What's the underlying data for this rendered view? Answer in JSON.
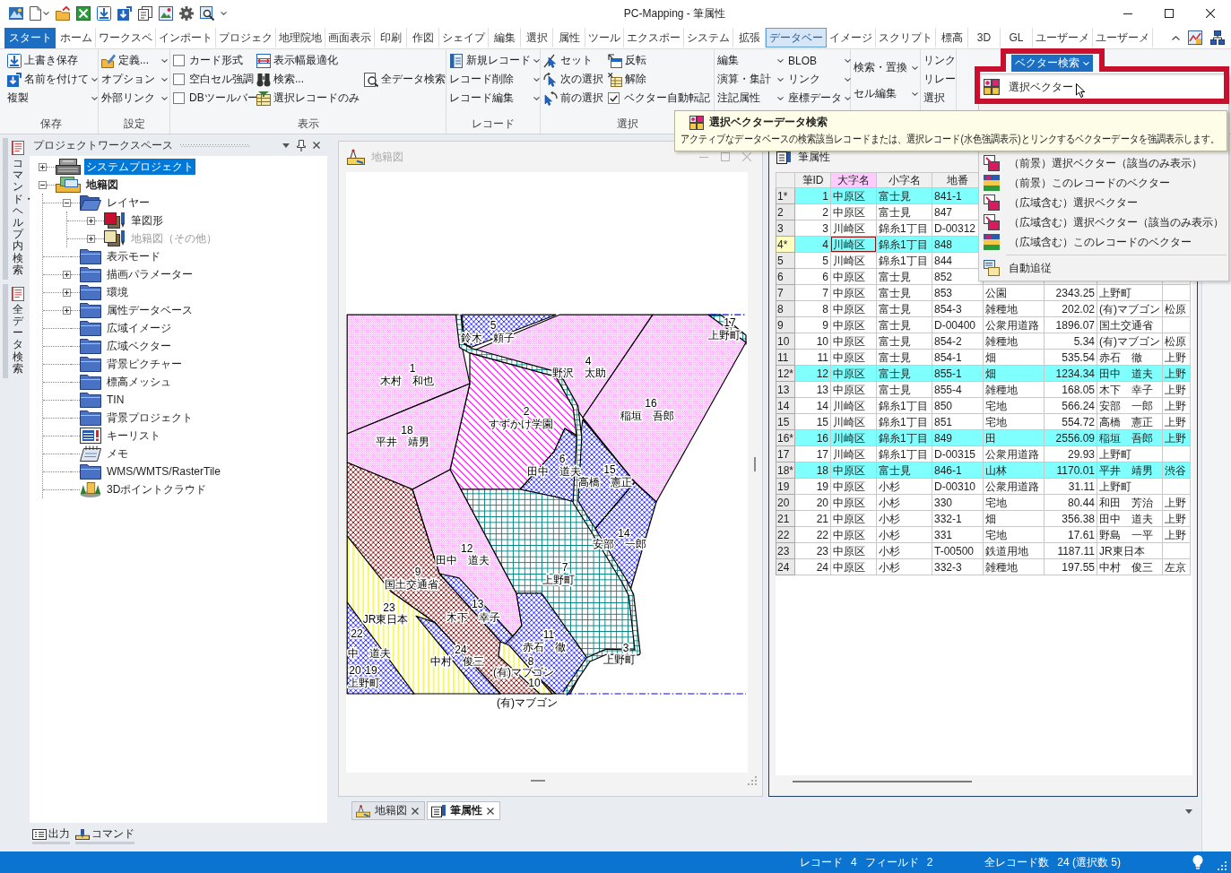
{
  "window": {
    "title": "PC-Mapping - 筆属性"
  },
  "ribbon": {
    "app_button": "スタート",
    "tabs": [
      {
        "label": "ホーム",
        "selected": false
      },
      {
        "label": "ワークスペ",
        "selected": false
      },
      {
        "label": "インポート",
        "selected": false
      },
      {
        "label": "プロジェク",
        "selected": false
      },
      {
        "label": "地理院地",
        "selected": false
      },
      {
        "label": "画面表示",
        "selected": false
      },
      {
        "label": "印刷",
        "selected": false
      },
      {
        "label": "作図",
        "selected": false
      },
      {
        "label": "シェイプ",
        "selected": false
      },
      {
        "label": "編集",
        "selected": false
      },
      {
        "label": "選択",
        "selected": false
      },
      {
        "label": "属性",
        "selected": false
      },
      {
        "label": "ツール",
        "selected": false
      },
      {
        "label": "エクスポー",
        "selected": false
      },
      {
        "label": "システム",
        "selected": false
      },
      {
        "label": "拡張",
        "selected": false
      },
      {
        "label": "データベー",
        "selected": true
      },
      {
        "label": "イメージ",
        "selected": false
      },
      {
        "label": "スクリプト",
        "selected": false
      },
      {
        "label": "標高",
        "selected": false
      },
      {
        "label": "3D",
        "selected": false
      },
      {
        "label": "GL",
        "selected": false
      },
      {
        "label": "ユーザーメ",
        "selected": false
      },
      {
        "label": "ユーザーメ",
        "selected": false
      }
    ],
    "groups": [
      {
        "label": "保存",
        "columns": [
          [
            {
              "kind": "icon",
              "label": "上書き保存"
            },
            {
              "kind": "icon_menu",
              "label": "名前を付けて"
            },
            {
              "kind": "menu",
              "label": "複製"
            }
          ]
        ]
      },
      {
        "label": "設定",
        "columns": [
          [
            {
              "kind": "icon_menu",
              "label": "定義..."
            },
            {
              "kind": "menu",
              "label": "オプション"
            },
            {
              "kind": "menu",
              "label": "外部リンク"
            }
          ]
        ]
      },
      {
        "label": "表示",
        "columns": [
          [
            {
              "kind": "check",
              "label": "カード形式",
              "checked": false
            },
            {
              "kind": "check",
              "label": "空白セル強調",
              "checked": false
            },
            {
              "kind": "check",
              "label": "DBツールバー",
              "checked": false
            }
          ],
          [
            {
              "kind": "icon",
              "label": "表示幅最適化"
            },
            {
              "kind": "icon",
              "label": "検索..."
            },
            {
              "kind": "icon",
              "label": "選択レコードのみ"
            }
          ],
          [
            {
              "kind": "icon",
              "label": "全データ検索"
            }
          ]
        ]
      },
      {
        "label": "レコード",
        "columns": [
          [
            {
              "kind": "icon_menu",
              "label": "新規レコード"
            },
            {
              "kind": "menu",
              "label": "レコード削除"
            },
            {
              "kind": "menu",
              "label": "レコード編集"
            }
          ]
        ]
      },
      {
        "label": "選択",
        "columns": [
          [
            {
              "kind": "icon",
              "label": "セット"
            },
            {
              "kind": "icon",
              "label": "次の選択"
            },
            {
              "kind": "icon",
              "label": "前の選択"
            }
          ],
          [
            {
              "kind": "icon",
              "label": "反転"
            },
            {
              "kind": "icon",
              "label": "解除"
            },
            {
              "kind": "check",
              "label": "ベクター自動転記",
              "checked": true
            }
          ]
        ]
      },
      {
        "columns": [
          [
            {
              "kind": "menu",
              "label": "編集"
            },
            {
              "kind": "menu",
              "label": "演算・集計"
            },
            {
              "kind": "menu",
              "label": "注記属性"
            }
          ],
          [
            {
              "kind": "menu",
              "label": "BLOB"
            },
            {
              "kind": "menu",
              "label": "リンク"
            },
            {
              "kind": "menu",
              "label": "座標データ"
            }
          ]
        ]
      },
      {
        "columns": [
          [
            {
              "kind": "menu",
              "label": "検索・置換"
            },
            {
              "kind": "menu",
              "label": "セル編集"
            }
          ]
        ]
      },
      {
        "columns": [
          [
            {
              "kind": "text",
              "label": "リンク"
            },
            {
              "kind": "text",
              "label": "リレー"
            },
            {
              "kind": "text",
              "label": "選択"
            }
          ]
        ]
      }
    ],
    "vector_search": {
      "label": "ベクター検索",
      "expanded": true
    }
  },
  "vector_menu": {
    "items": [
      {
        "kind": "item",
        "label": "選択ベクター",
        "selected": true
      },
      {
        "kind": "item",
        "label": "（前景）選択ベクター（該当のみ表示）",
        "selected": false
      },
      {
        "kind": "item",
        "label": "（前景）このレコードのベクター",
        "selected": false
      },
      {
        "kind": "item",
        "label": "（広域含む）選択ベクター",
        "selected": false
      },
      {
        "kind": "item",
        "label": "（広域含む）選択ベクター（該当のみ表示）",
        "selected": false
      },
      {
        "kind": "item",
        "label": "（広域含む）このレコードのベクター",
        "selected": false
      },
      {
        "kind": "separator"
      },
      {
        "kind": "item",
        "label": "自動追従",
        "selected": false
      }
    ]
  },
  "tooltip": {
    "title": "選択ベクターデータ検索",
    "text": "アクティブなデータベースの検索該当レコードまたは、選択レコード(水色強調表示)とリンクするベクターデータを強調表示します。"
  },
  "side_tabs": [
    {
      "label": "コマンド・ヘルプ内検索"
    },
    {
      "label": "全データ検索"
    }
  ],
  "workspace": {
    "title": "プロジェクトワークスペース",
    "tree": [
      {
        "kind": "system",
        "label": "システムプロジェクト",
        "expanded": false,
        "selected": true,
        "active": false
      },
      {
        "kind": "project",
        "label": "地籍図",
        "expanded": true,
        "selected": false,
        "active": true,
        "children": [
          {
            "kind": "open_folder",
            "label": "レイヤー",
            "expanded": true,
            "selected": false,
            "children": [
              {
                "kind": "layer",
                "label": "筆図形",
                "expanded": false,
                "selected": false,
                "disabled": false,
                "color": "#c8102e"
              },
              {
                "kind": "layer",
                "label": "地籍図（その他）",
                "expanded": false,
                "selected": false,
                "disabled": true,
                "color": "#efe3b4"
              }
            ]
          },
          {
            "kind": "folder",
            "label": "表示モード",
            "selected": false
          },
          {
            "kind": "folder",
            "label": "描画パラメーター",
            "expanded": false,
            "selected": false
          },
          {
            "kind": "folder",
            "label": "環境",
            "expanded": false,
            "selected": false
          },
          {
            "kind": "folder",
            "label": "属性データベース",
            "expanded": false,
            "selected": false
          },
          {
            "kind": "folder",
            "label": "広域イメージ",
            "selected": false
          },
          {
            "kind": "folder",
            "label": "広域ベクター",
            "selected": false
          },
          {
            "kind": "folder",
            "label": "背景ピクチャー",
            "selected": false
          },
          {
            "kind": "folder",
            "label": "標高メッシュ",
            "selected": false
          },
          {
            "kind": "folder",
            "label": "TIN",
            "selected": false
          },
          {
            "kind": "folder",
            "label": "背景プロジェクト",
            "selected": false
          },
          {
            "kind": "keylist",
            "label": "キーリスト",
            "selected": false
          },
          {
            "kind": "memo",
            "label": "メモ",
            "selected": false
          },
          {
            "kind": "folder",
            "label": "WMS/WMTS/RasterTile",
            "selected": false
          },
          {
            "kind": "pointcloud",
            "label": "3Dポイントクラウド",
            "selected": false
          }
        ]
      }
    ]
  },
  "panel_tabs": [
    {
      "label": "出力"
    },
    {
      "label": "コマンド"
    }
  ],
  "map_window": {
    "title": "地籍図",
    "active": false,
    "parcels": [
      {
        "number": "5",
        "name": "鈴木　頼子",
        "kind": "bluehatch"
      },
      {
        "number": "17",
        "name": "上野町",
        "kind": "grid"
      },
      {
        "number": "1",
        "name": "木村　和也",
        "kind": "dots"
      },
      {
        "number": "4",
        "name": "野沢　太助",
        "kind": "dots"
      },
      {
        "number": "16",
        "name": "稲垣　吾郎",
        "kind": "dots"
      },
      {
        "number": "2",
        "name": "すずかけ学園",
        "kind": "diagonal"
      },
      {
        "number": "18",
        "name": "平井　靖男",
        "kind": "dots"
      },
      {
        "number": "6",
        "name": "田中　道夫",
        "kind": "bluehatch"
      },
      {
        "number": "15",
        "name": "高橋　憲正",
        "kind": "bluehatch"
      },
      {
        "number": "14",
        "name": "安部　一郎",
        "kind": "bluehatch"
      },
      {
        "number": "12",
        "name": "田中　道夫",
        "kind": "dots"
      },
      {
        "number": "9",
        "name": "国土交通省",
        "kind": "brownhatch"
      },
      {
        "number": "7",
        "name": "上野町",
        "kind": "grid"
      },
      {
        "number": "23",
        "name": "JR東日本",
        "kind": "stripes"
      },
      {
        "number": "13",
        "name": "木下　幸子",
        "kind": "bluehatch"
      },
      {
        "number": "22",
        "kind": "bluehatch"
      },
      {
        "name": "中　道夫"
      },
      {
        "number": "20"
      },
      {
        "number": "19",
        "name": "上野町"
      },
      {
        "number": "24",
        "name": "中村　俊三",
        "kind": "bluehatch"
      },
      {
        "number": "11",
        "name": "赤石　徹",
        "kind": "bluehatch"
      },
      {
        "number": "8",
        "name": "(有)マブゴン",
        "kind": "stripes"
      },
      {
        "number": "10",
        "name": "(有)マブゴン"
      },
      {
        "number": "3",
        "name": "上野町",
        "kind": "road"
      }
    ]
  },
  "table_window": {
    "title": "筆属性",
    "active": true,
    "columns": [
      {
        "label": "筆ID",
        "selected": false
      },
      {
        "label": "大字名",
        "selected": true
      },
      {
        "label": "小字名",
        "selected": false
      },
      {
        "label": "地番",
        "selected": false
      }
    ],
    "rows": [
      {
        "header": "1*",
        "selected": true,
        "current": false,
        "cells": [
          "1",
          "中原区",
          "富士見",
          "841-1"
        ]
      },
      {
        "header": "2",
        "selected": false,
        "current": false,
        "cells": [
          "2",
          "中原区",
          "富士見",
          "847"
        ]
      },
      {
        "header": "3",
        "selected": false,
        "current": false,
        "cells": [
          "3",
          "川崎区",
          "錦糸1丁目",
          "D-00312"
        ]
      },
      {
        "header": "4*",
        "selected": true,
        "current": true,
        "cells": [
          "4",
          "川崎区",
          "錦糸1丁目",
          "848"
        ]
      },
      {
        "header": "5",
        "selected": false,
        "current": false,
        "cells": [
          "5",
          "川崎区",
          "錦糸1丁目",
          "844"
        ]
      },
      {
        "header": "6",
        "selected": false,
        "current": false,
        "cells": [
          "6",
          "中原区",
          "富士見",
          "852"
        ]
      },
      {
        "header": "7",
        "selected": false,
        "current": false,
        "cells": [
          "7",
          "中原区",
          "富士見",
          "853",
          "公園",
          "2343.25",
          "上野町"
        ]
      },
      {
        "header": "8",
        "selected": false,
        "current": false,
        "cells": [
          "8",
          "中原区",
          "富士見",
          "854-3",
          "雑種地",
          "202.02",
          "(有)マブゴン",
          "松原"
        ]
      },
      {
        "header": "9",
        "selected": false,
        "current": false,
        "cells": [
          "9",
          "中原区",
          "富士見",
          "D-00400",
          "公衆用道路",
          "1896.07",
          "国土交通省"
        ]
      },
      {
        "header": "10",
        "selected": false,
        "current": false,
        "cells": [
          "10",
          "中原区",
          "富士見",
          "854-2",
          "雑種地",
          "5.34",
          "(有)マブゴン",
          "松原"
        ]
      },
      {
        "header": "11",
        "selected": false,
        "current": false,
        "cells": [
          "11",
          "中原区",
          "富士見",
          "854-1",
          "畑",
          "535.54",
          "赤石　徹",
          "上野"
        ]
      },
      {
        "header": "12*",
        "selected": true,
        "current": false,
        "cells": [
          "12",
          "中原区",
          "富士見",
          "855-1",
          "畑",
          "1234.34",
          "田中　道夫",
          "上野"
        ]
      },
      {
        "header": "13",
        "selected": false,
        "current": false,
        "cells": [
          "13",
          "中原区",
          "富士見",
          "855-4",
          "雑種地",
          "168.05",
          "木下　幸子",
          "上野"
        ]
      },
      {
        "header": "14",
        "selected": false,
        "current": false,
        "cells": [
          "14",
          "川崎区",
          "錦糸1丁目",
          "850",
          "宅地",
          "566.24",
          "安部　一郎",
          "上野"
        ]
      },
      {
        "header": "15",
        "selected": false,
        "current": false,
        "cells": [
          "15",
          "川崎区",
          "錦糸1丁目",
          "851",
          "宅地",
          "554.72",
          "高橋　憲正",
          "上野"
        ]
      },
      {
        "header": "16*",
        "selected": true,
        "current": false,
        "cells": [
          "16",
          "川崎区",
          "錦糸1丁目",
          "849",
          "田",
          "2556.09",
          "稲垣　吾郎",
          "上野"
        ]
      },
      {
        "header": "17",
        "selected": false,
        "current": false,
        "cells": [
          "17",
          "川崎区",
          "錦糸1丁目",
          "D-00315",
          "公衆用道路",
          "29.93",
          "上野町"
        ]
      },
      {
        "header": "18*",
        "selected": true,
        "current": false,
        "cells": [
          "18",
          "中原区",
          "富士見",
          "846-1",
          "山林",
          "1170.01",
          "平井　靖男",
          "渋谷"
        ]
      },
      {
        "header": "19",
        "selected": false,
        "current": false,
        "cells": [
          "19",
          "中原区",
          "小杉",
          "D-00310",
          "公衆用道路",
          "31.11",
          "上野町"
        ]
      },
      {
        "header": "20",
        "selected": false,
        "current": false,
        "cells": [
          "20",
          "中原区",
          "小杉",
          "330",
          "宅地",
          "80.44",
          "和田　芳治",
          "上野"
        ]
      },
      {
        "header": "21",
        "selected": false,
        "current": false,
        "cells": [
          "21",
          "中原区",
          "小杉",
          "332-1",
          "畑",
          "356.38",
          "田中　道夫",
          "上野"
        ]
      },
      {
        "header": "22",
        "selected": false,
        "current": false,
        "cells": [
          "22",
          "中原区",
          "小杉",
          "331",
          "宅地",
          "17.61",
          "野島　一平",
          "上野"
        ]
      },
      {
        "header": "23",
        "selected": false,
        "current": false,
        "cells": [
          "23",
          "中原区",
          "小杉",
          "T-00500",
          "鉄道用地",
          "1187.11",
          "JR東日本"
        ]
      },
      {
        "header": "24",
        "selected": false,
        "current": false,
        "cells": [
          "24",
          "中原区",
          "小杉",
          "332-3",
          "雑種地",
          "197.55",
          "中村　俊三",
          "左京"
        ]
      }
    ]
  },
  "doc_tabs": [
    {
      "label": "地籍図",
      "selected": false
    },
    {
      "label": "筆属性",
      "selected": true
    }
  ],
  "status": {
    "items": [
      {
        "label": "レコード",
        "value": "4"
      },
      {
        "label": "フィールド",
        "value": "2"
      },
      {
        "label": "全レコード数",
        "value": "24 (選択数 5)"
      }
    ]
  }
}
